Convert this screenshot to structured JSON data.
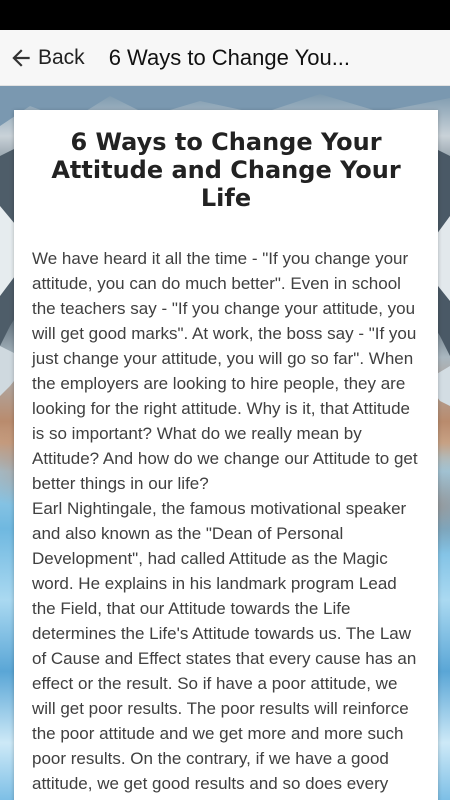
{
  "app_bar": {
    "back_label": "Back",
    "title": "6 Ways to Change You..."
  },
  "article": {
    "title": "6 Ways to Change Your Attitude and Change Your Life",
    "paragraphs": [
      "We have heard it all the time - \"If you change your attitude, you can do much better\". Even in school the teachers say - \"If you change your attitude, you will get good marks\". At work, the boss say - \"If you just change your attitude, you will go so far\". When the employers are looking to hire people, they are looking for the right attitude. Why is it, that Attitude is so important? What do we really mean by Attitude? And how do we change our Attitude to get better things in our life?",
      "Earl Nightingale, the famous motivational speaker and also known as the \"Dean of Personal Development\", had called Attitude as the Magic word. He explains in his landmark program Lead the Field, that our Attitude towards the Life determines the Life's Attitude towards us. The Law of Cause and Effect states that every cause has an effect or the result. So if have a poor attitude, we will get poor results. The poor results will reinforce the poor attitude and we get more and more such poor results. On the contrary, if we have a good attitude, we get good results and so does every successful person around us -"
    ]
  },
  "colors": {
    "app_bar_bg": "#f7f7f7",
    "status_bar_bg": "#000000",
    "card_bg": "#ffffff",
    "title_text": "#222222",
    "body_text": "#404040"
  }
}
